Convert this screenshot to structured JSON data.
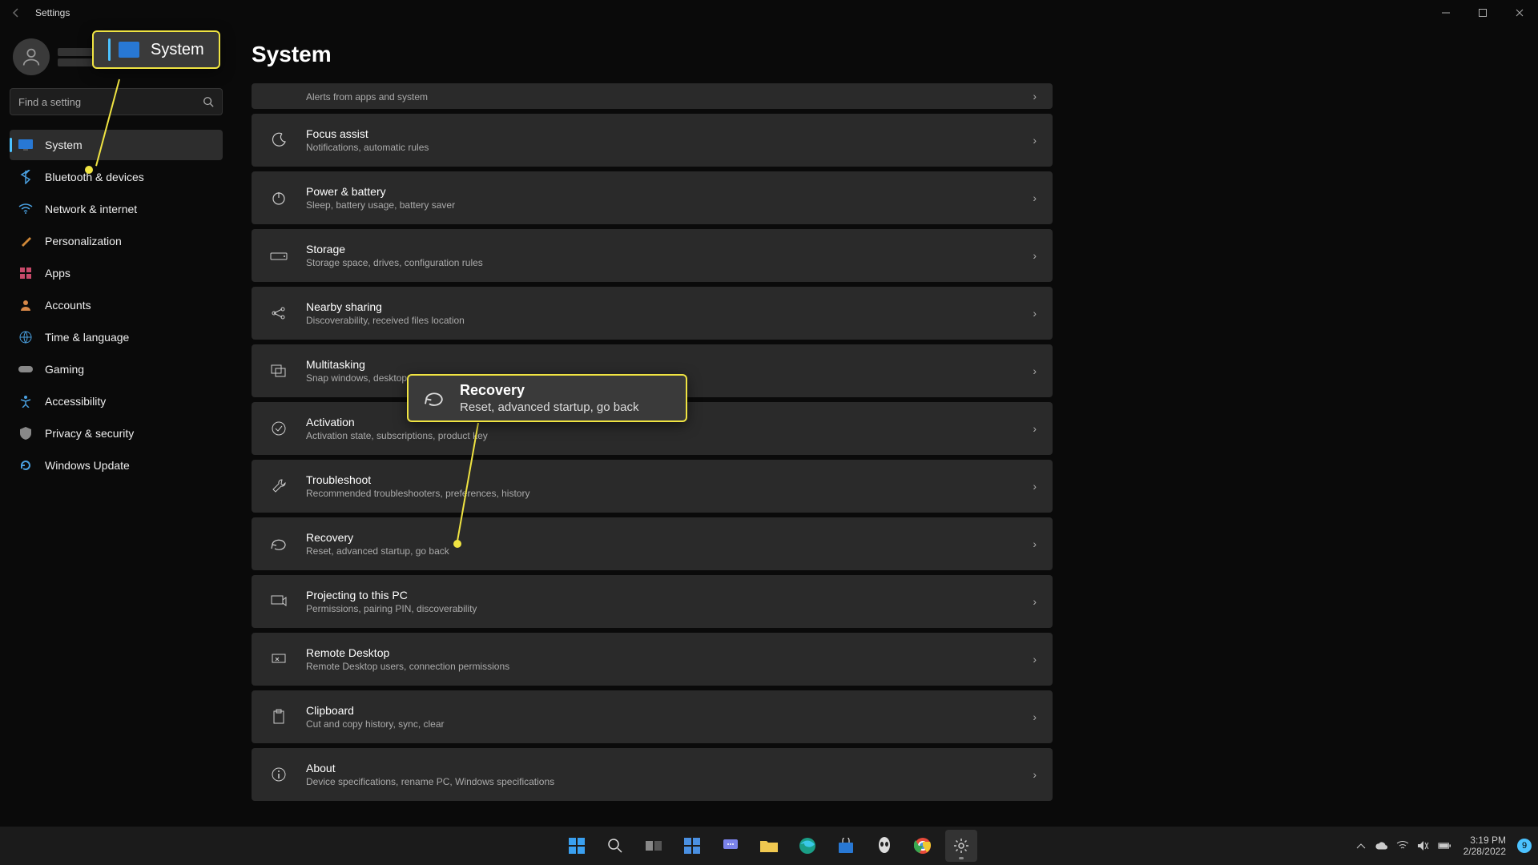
{
  "window": {
    "title": "Settings"
  },
  "search": {
    "placeholder": "Find a setting"
  },
  "page": {
    "title": "System"
  },
  "nav": [
    {
      "label": "System"
    },
    {
      "label": "Bluetooth & devices"
    },
    {
      "label": "Network & internet"
    },
    {
      "label": "Personalization"
    },
    {
      "label": "Apps"
    },
    {
      "label": "Accounts"
    },
    {
      "label": "Time & language"
    },
    {
      "label": "Gaming"
    },
    {
      "label": "Accessibility"
    },
    {
      "label": "Privacy & security"
    },
    {
      "label": "Windows Update"
    }
  ],
  "rows": [
    {
      "title": "",
      "sub": "Alerts from apps and system"
    },
    {
      "title": "Focus assist",
      "sub": "Notifications, automatic rules"
    },
    {
      "title": "Power & battery",
      "sub": "Sleep, battery usage, battery saver"
    },
    {
      "title": "Storage",
      "sub": "Storage space, drives, configuration rules"
    },
    {
      "title": "Nearby sharing",
      "sub": "Discoverability, received files location"
    },
    {
      "title": "Multitasking",
      "sub": "Snap windows, desktops, task switching"
    },
    {
      "title": "Activation",
      "sub": "Activation state, subscriptions, product key"
    },
    {
      "title": "Troubleshoot",
      "sub": "Recommended troubleshooters, preferences, history"
    },
    {
      "title": "Recovery",
      "sub": "Reset, advanced startup, go back"
    },
    {
      "title": "Projecting to this PC",
      "sub": "Permissions, pairing PIN, discoverability"
    },
    {
      "title": "Remote Desktop",
      "sub": "Remote Desktop users, connection permissions"
    },
    {
      "title": "Clipboard",
      "sub": "Cut and copy history, sync, clear"
    },
    {
      "title": "About",
      "sub": "Device specifications, rename PC, Windows specifications"
    }
  ],
  "callout": {
    "system": "System",
    "recovery_title": "Recovery",
    "recovery_sub": "Reset, advanced startup, go back"
  },
  "tray": {
    "time": "3:19 PM",
    "date": "2/28/2022",
    "badge": "9"
  }
}
